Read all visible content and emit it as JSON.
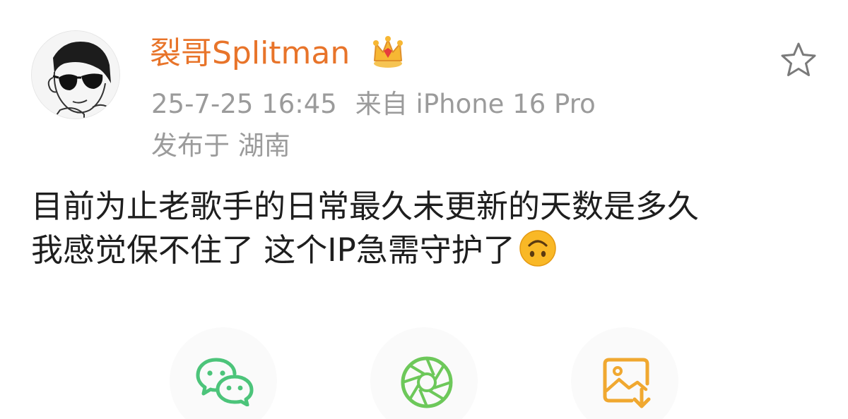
{
  "post": {
    "username": "裂哥Splitman",
    "timestamp": "25-7-25 16:45",
    "source": "来自 iPhone 16 Pro",
    "location": "发布于 湖南",
    "text_line1": "目前为止老歌手的日常最久未更新的天数是多久",
    "text_line2": "我感觉保不住了 这个IP急需守护了"
  },
  "icons": {
    "avatar": "avatar-sunglasses-portrait",
    "badge": "crown-icon",
    "favorite": "star-outline-icon",
    "emoji": "upside-down-face-emoji",
    "share": [
      "wechat-icon",
      "moments-icon",
      "save-image-icon"
    ]
  },
  "colors": {
    "username": "#e8742a",
    "meta": "#9b9b9b",
    "text": "#1e1e1e",
    "wechat_green": "#4cc47a",
    "moments_green": "#6dc85a",
    "save_orange": "#f0a830"
  }
}
